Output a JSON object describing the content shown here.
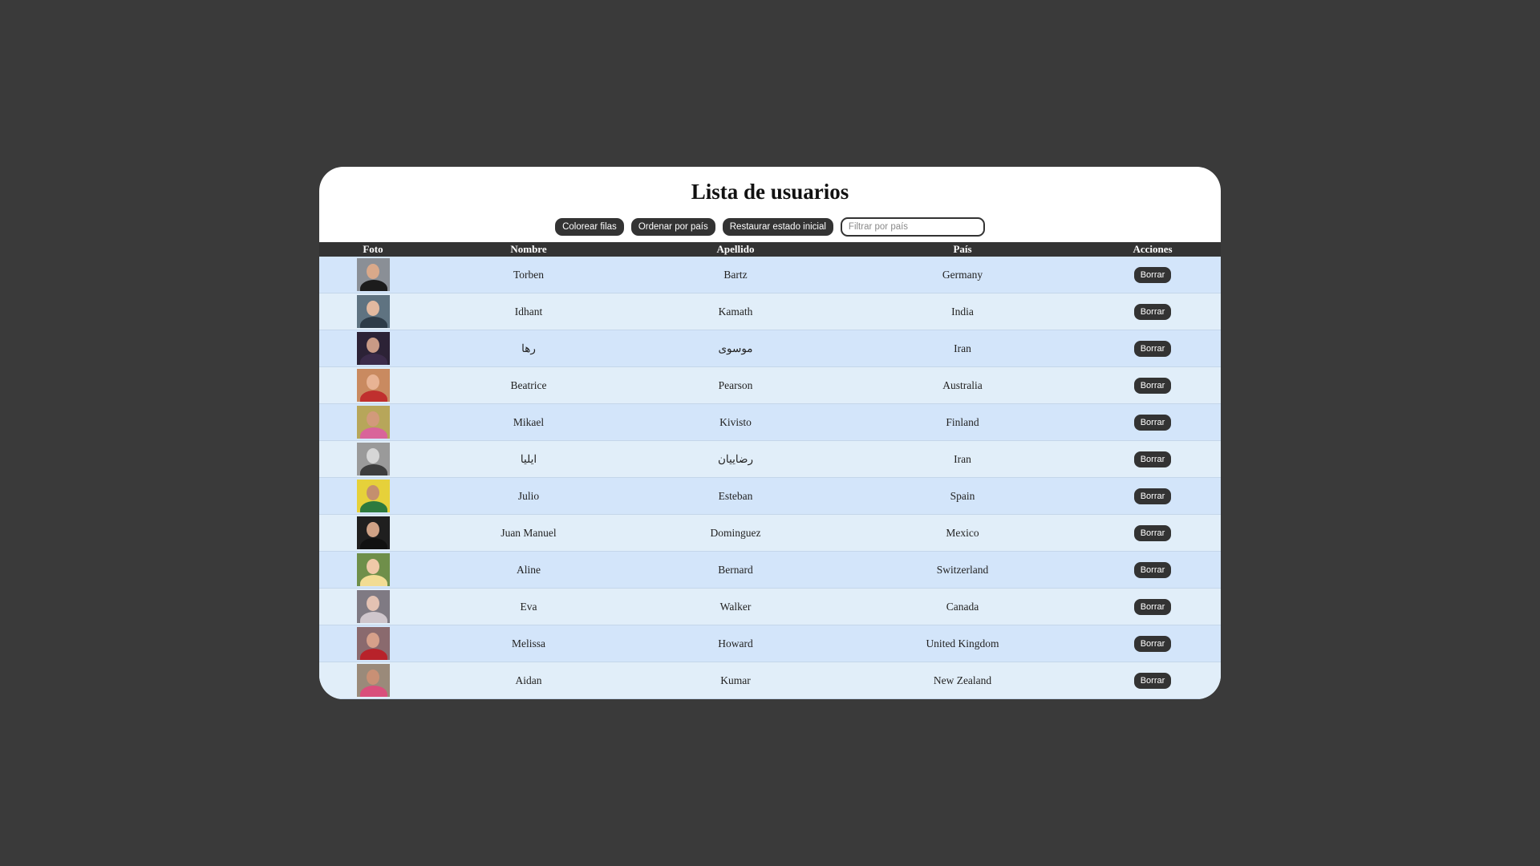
{
  "title": "Lista de usuarios",
  "toolbar": {
    "color_rows_label": "Colorear filas",
    "sort_country_label": "Ordenar por país",
    "restore_label": "Restaurar estado inicial",
    "filter_placeholder": "Filtrar por país",
    "filter_value": ""
  },
  "table": {
    "headers": {
      "photo": "Foto",
      "first_name": "Nombre",
      "last_name": "Apellido",
      "country": "País",
      "actions": "Acciones"
    },
    "rows": [
      {
        "first": "Torben",
        "last": "Bartz",
        "country": "Germany",
        "action": "Borrar",
        "photo": "avatar-man-suit"
      },
      {
        "first": "Idhant",
        "last": "Kamath",
        "country": "India",
        "action": "Borrar",
        "photo": "avatar-man"
      },
      {
        "first": "رها",
        "last": "موسوی",
        "country": "Iran",
        "action": "Borrar",
        "photo": "avatar-woman"
      },
      {
        "first": "Beatrice",
        "last": "Pearson",
        "country": "Australia",
        "action": "Borrar",
        "photo": "avatar-woman-red"
      },
      {
        "first": "Mikael",
        "last": "Kivisto",
        "country": "Finland",
        "action": "Borrar",
        "photo": "avatar-man-beard"
      },
      {
        "first": "ایلیا",
        "last": "رضاییان",
        "country": "Iran",
        "action": "Borrar",
        "photo": "avatar-man-bw"
      },
      {
        "first": "Julio",
        "last": "Esteban",
        "country": "Spain",
        "action": "Borrar",
        "photo": "avatar-man-yellow"
      },
      {
        "first": "Juan Manuel",
        "last": "Dominguez",
        "country": "Mexico",
        "action": "Borrar",
        "photo": "avatar-man-dark"
      },
      {
        "first": "Aline",
        "last": "Bernard",
        "country": "Switzerland",
        "action": "Borrar",
        "photo": "avatar-woman-blonde"
      },
      {
        "first": "Eva",
        "last": "Walker",
        "country": "Canada",
        "action": "Borrar",
        "photo": "avatar-woman-grey"
      },
      {
        "first": "Melissa",
        "last": "Howard",
        "country": "United Kingdom",
        "action": "Borrar",
        "photo": "avatar-woman-red-shirt"
      },
      {
        "first": "Aidan",
        "last": "Kumar",
        "country": "New Zealand",
        "action": "Borrar",
        "photo": "avatar-man-pink"
      }
    ]
  },
  "colors": {
    "page_bg": "#3a3a3a",
    "card_bg": "#ffffff",
    "header_bg": "#333333",
    "row_odd": "#d3e5fa",
    "row_even": "#e1eef9",
    "button_bg": "#333333"
  },
  "avatars": {
    "avatar-man-suit": {
      "bg": "#8a8f96",
      "skin": "#d9a98a",
      "cloth": "#1c1c1c"
    },
    "avatar-man": {
      "bg": "#5f7381",
      "skin": "#e2b9a0",
      "cloth": "#2d3b47"
    },
    "avatar-woman": {
      "bg": "#2c2236",
      "skin": "#c99a86",
      "cloth": "#3b2b4a"
    },
    "avatar-woman-red": {
      "bg": "#c98a60",
      "skin": "#e8b394",
      "cloth": "#c0302e"
    },
    "avatar-man-beard": {
      "bg": "#b7a65a",
      "skin": "#d29a7b",
      "cloth": "#d9649a"
    },
    "avatar-man-bw": {
      "bg": "#9a9a9a",
      "skin": "#d6d6d6",
      "cloth": "#3d3d3d"
    },
    "avatar-man-yellow": {
      "bg": "#e6d13a",
      "skin": "#c48f6e",
      "cloth": "#2d7a3e"
    },
    "avatar-man-dark": {
      "bg": "#1f1f1f",
      "skin": "#cfa286",
      "cloth": "#111111"
    },
    "avatar-woman-blonde": {
      "bg": "#6f8f4a",
      "skin": "#f0c9a8",
      "cloth": "#f2dc93"
    },
    "avatar-woman-grey": {
      "bg": "#7f7a83",
      "skin": "#e3c2b3",
      "cloth": "#cfc6cc"
    },
    "avatar-woman-red-shirt": {
      "bg": "#8a6a6e",
      "skin": "#d6a08a",
      "cloth": "#b8222a"
    },
    "avatar-man-pink": {
      "bg": "#9a8a7a",
      "skin": "#c99075",
      "cloth": "#d94f7c"
    }
  }
}
